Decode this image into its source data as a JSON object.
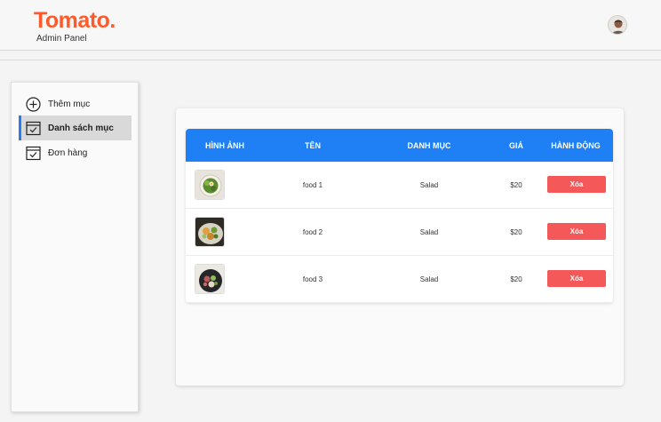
{
  "header": {
    "brand": "Tomato.",
    "subtitle": "Admin Panel"
  },
  "sidebar": {
    "items": [
      {
        "label": "Thêm mục",
        "icon": "plus-circle-icon",
        "active": false
      },
      {
        "label": "Danh sách mục",
        "icon": "check-square-icon",
        "active": true
      },
      {
        "label": "Đơn hàng",
        "icon": "check-square-icon",
        "active": false
      }
    ]
  },
  "table": {
    "headers": [
      "HÌNH ẢNH",
      "TÊN",
      "DANH MỤC",
      "GIÁ",
      "HÀNH ĐỘNG"
    ],
    "rows": [
      {
        "name": "food 1",
        "category": "Salad",
        "price": "$20",
        "action": "Xóa"
      },
      {
        "name": "food 2",
        "category": "Salad",
        "price": "$20",
        "action": "Xóa"
      },
      {
        "name": "food 3",
        "category": "Salad",
        "price": "$20",
        "action": "Xóa"
      }
    ]
  },
  "colors": {
    "brand": "#ff5a2c",
    "table_header": "#1f7ff5",
    "delete_button": "#f45858",
    "active_indicator": "#2b7bef"
  }
}
